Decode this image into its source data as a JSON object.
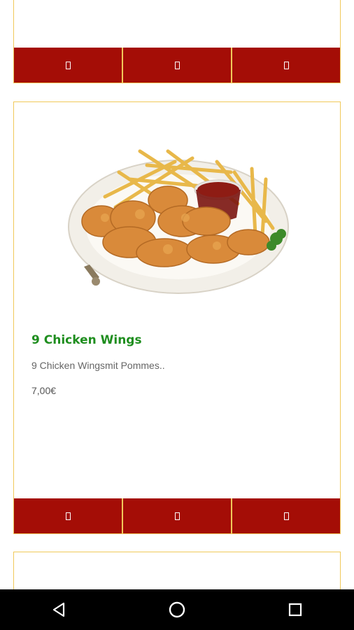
{
  "product": {
    "name": "9 Chicken Wings",
    "description": "9 Chicken Wingsmit Pommes..",
    "price": "7,00€"
  },
  "action_buttons": [
    "action-1",
    "action-2",
    "action-3"
  ],
  "colors": {
    "button_bar": "#a40d06",
    "card_border": "#f0c95a",
    "title": "#1f8e1f",
    "nav_bar": "#000000"
  },
  "icons": {
    "nav_back": "triangle-back-icon",
    "nav_home": "circle-home-icon",
    "nav_recents": "square-recents-icon"
  }
}
